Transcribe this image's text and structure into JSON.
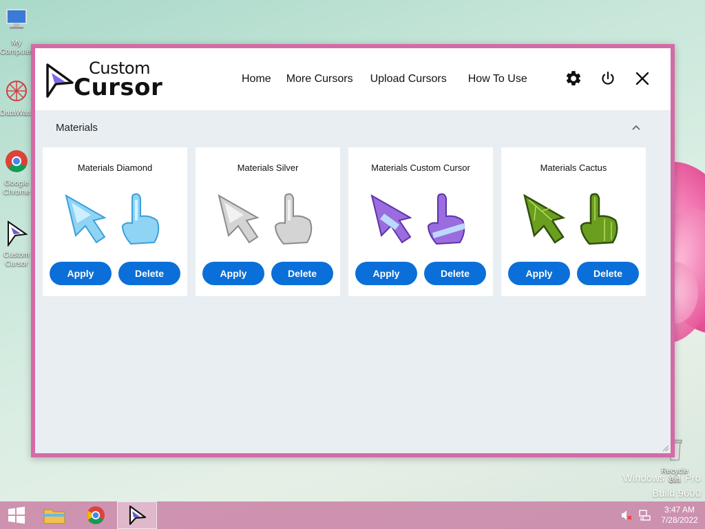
{
  "desktop": {
    "icons": [
      {
        "label": "My Computer"
      },
      {
        "label": "DataWatch"
      },
      {
        "label": "Google Chrome"
      },
      {
        "label": "Custom Cursor"
      }
    ],
    "recycle_bin": "Recycle Bin",
    "watermark_line1": "Windows 8.1 Pro",
    "watermark_line2": "Build 9600"
  },
  "app": {
    "logo_line1": "Custom",
    "logo_line2": "Cursor",
    "nav": [
      "Home",
      "More Cursors",
      "Upload Cursors",
      "How To Use"
    ],
    "section_title": "Materials",
    "apply_label": "Apply",
    "delete_label": "Delete",
    "cards": [
      {
        "title": "Materials Diamond",
        "color": "#8fd3f5"
      },
      {
        "title": "Materials Silver",
        "color": "#c9c9c9"
      },
      {
        "title": "Materials Custom Cursor",
        "color": "#9b6be0"
      },
      {
        "title": "Materials Cactus",
        "color": "#6a9e1f"
      }
    ]
  },
  "taskbar": {
    "time": "3:47 AM",
    "date": "7/28/2022"
  },
  "colors": {
    "window_border": "#d46aa6",
    "button": "#0a6fd9",
    "taskbar": "#c878a0"
  }
}
